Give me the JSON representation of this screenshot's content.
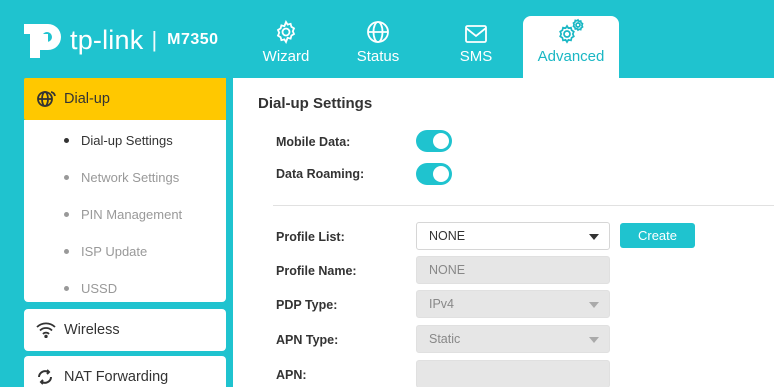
{
  "brand": {
    "name": "tp-link",
    "separator": "|",
    "model": "M7350"
  },
  "tabs": [
    {
      "label": "Wizard",
      "icon": "gear-icon"
    },
    {
      "label": "Status",
      "icon": "globe-icon"
    },
    {
      "label": "SMS",
      "icon": "envelope-icon"
    },
    {
      "label": "Advanced",
      "icon": "gears-icon"
    }
  ],
  "active_tab": "Advanced",
  "sidebar": {
    "groups": [
      {
        "label": "Dial-up",
        "icon": "globe-dialup-icon",
        "active": true
      },
      {
        "label": "Wireless",
        "icon": "wifi-icon",
        "active": false
      },
      {
        "label": "NAT Forwarding",
        "icon": "nat-forwarding-icon",
        "active": false
      }
    ],
    "subitems": [
      {
        "label": "Dial-up Settings",
        "active": true
      },
      {
        "label": "Network Settings",
        "active": false
      },
      {
        "label": "PIN Management",
        "active": false
      },
      {
        "label": "ISP Update",
        "active": false
      },
      {
        "label": "USSD",
        "active": false
      }
    ]
  },
  "main": {
    "title": "Dial-up Settings",
    "mobile_data": {
      "label": "Mobile Data:",
      "on": true
    },
    "data_roaming": {
      "label": "Data Roaming:",
      "on": true
    },
    "profile_list": {
      "label": "Profile List:",
      "value": "NONE"
    },
    "create_label": "Create",
    "profile_name": {
      "label": "Profile Name:",
      "value": "NONE"
    },
    "pdp_type": {
      "label": "PDP Type:",
      "value": "IPv4"
    },
    "apn_type": {
      "label": "APN Type:",
      "value": "Static"
    },
    "apn": {
      "label": "APN:",
      "value": ""
    }
  },
  "colors": {
    "accent": "#1fc3cf",
    "active_group": "#ffc800",
    "text": "#333333",
    "muted": "#999999"
  }
}
